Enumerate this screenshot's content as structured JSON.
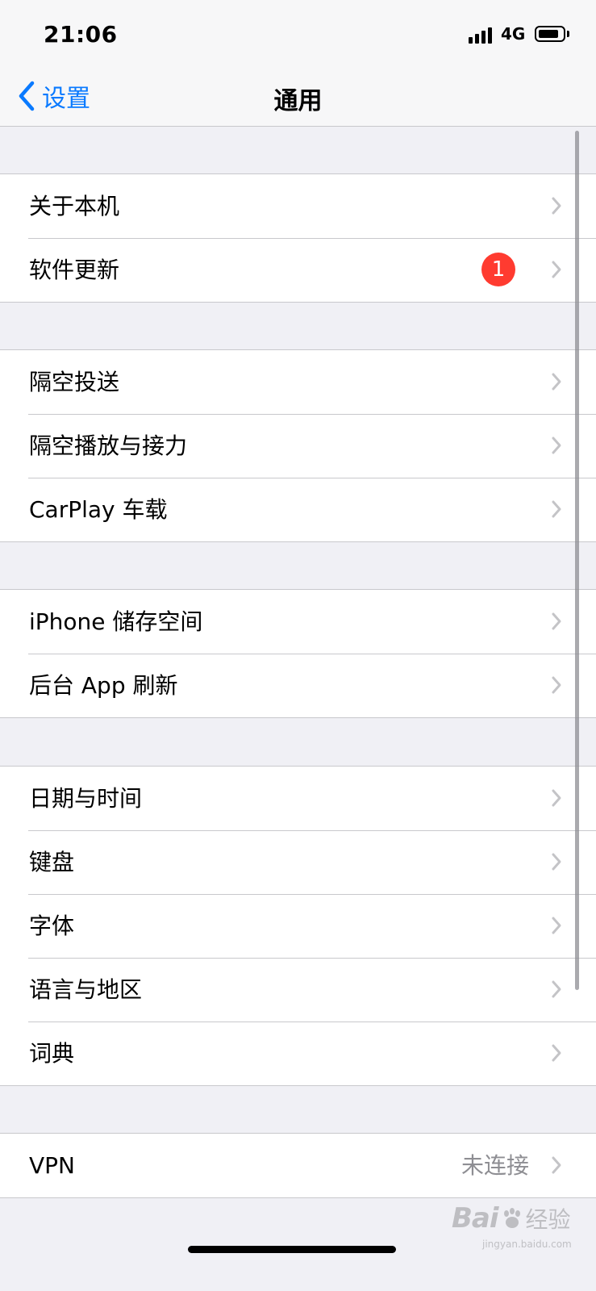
{
  "status_bar": {
    "time": "21:06",
    "network": "4G"
  },
  "nav": {
    "back_label": "设置",
    "title": "通用"
  },
  "groups": [
    {
      "items": [
        {
          "label": "关于本机"
        },
        {
          "label": "软件更新",
          "badge": "1"
        }
      ]
    },
    {
      "items": [
        {
          "label": "隔空投送"
        },
        {
          "label": "隔空播放与接力"
        },
        {
          "label": "CarPlay 车载"
        }
      ]
    },
    {
      "items": [
        {
          "label": "iPhone 储存空间"
        },
        {
          "label": "后台 App 刷新"
        }
      ]
    },
    {
      "items": [
        {
          "label": "日期与时间"
        },
        {
          "label": "键盘"
        },
        {
          "label": "字体"
        },
        {
          "label": "语言与地区"
        },
        {
          "label": "词典"
        }
      ]
    },
    {
      "items": [
        {
          "label": "VPN",
          "value": "未连接"
        }
      ]
    }
  ],
  "colors": {
    "accent": "#0a7aff",
    "badge": "#ff3b30",
    "background": "#f0f0f5",
    "separator": "#c8c8cc",
    "chevron": "#c4c4c7"
  },
  "watermark": {
    "brand": "Bai",
    "suffix": "经验",
    "url": "jingyan.baidu.com"
  }
}
